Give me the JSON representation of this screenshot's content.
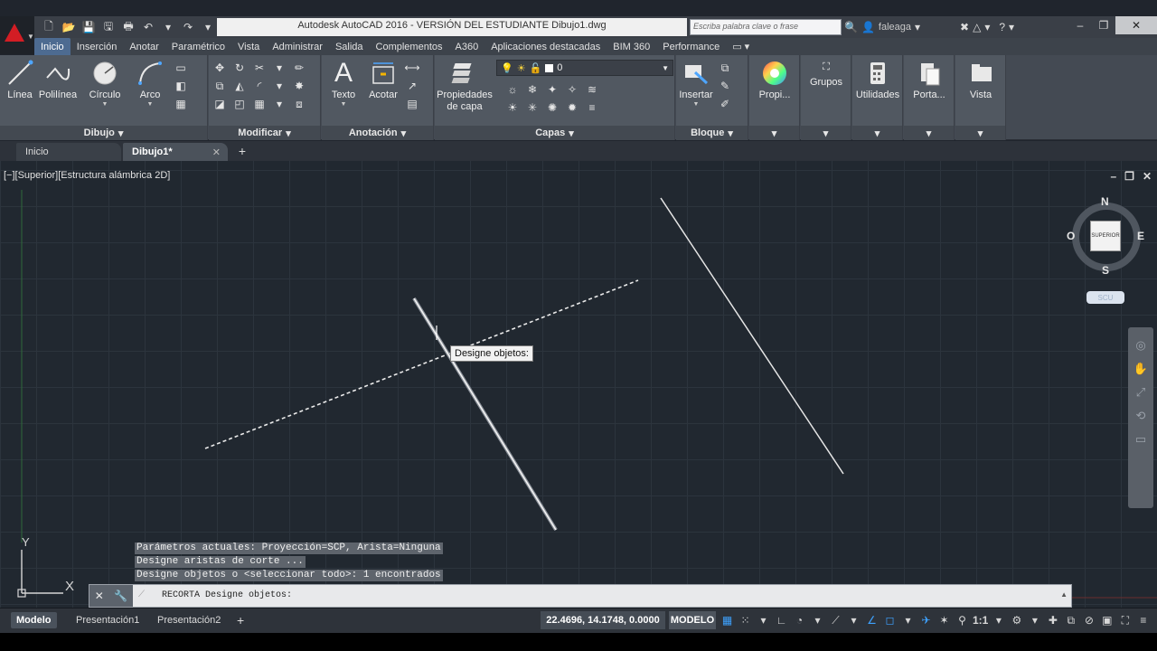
{
  "window": {
    "title": "Autodesk AutoCAD 2016 - VERSIÓN DEL ESTUDIANTE    Dibujo1.dwg",
    "search_placeholder": "Escriba palabra clave o frase",
    "user": "faleaga"
  },
  "ribbon_tabs": [
    "Inicio",
    "Inserción",
    "Anotar",
    "Paramétrico",
    "Vista",
    "Administrar",
    "Salida",
    "Complementos",
    "A360",
    "Aplicaciones destacadas",
    "BIM 360",
    "Performance"
  ],
  "ribbon": {
    "dibujo": {
      "title": "Dibujo",
      "linea": "Línea",
      "polilinea": "Polilínea",
      "circulo": "Círculo",
      "arco": "Arco"
    },
    "modificar": {
      "title": "Modificar"
    },
    "anotacion": {
      "title": "Anotación",
      "texto": "Texto",
      "acotar": "Acotar"
    },
    "capas": {
      "title": "Capas",
      "propiedades": "Propiedades",
      "de_capa": "de capa",
      "layer_value": "0"
    },
    "bloque": {
      "title": "Bloque",
      "insertar": "Insertar"
    },
    "propi": "Propi...",
    "grupos": "Grupos",
    "utilidades": "Utilidades",
    "porta": "Porta...",
    "vista": "Vista"
  },
  "doc_tabs": {
    "inicio": "Inicio",
    "dibujo1": "Dibujo1*"
  },
  "viewport": {
    "label": "[−][Superior][Estructura alámbrica 2D]",
    "tooltip": "Designe objetos:",
    "viewcube": {
      "n": "N",
      "s": "S",
      "e": "E",
      "o": "O",
      "face": "SUPERIOR",
      "scu": "SCU"
    },
    "ucs_y": "Y",
    "ucs_x": "X"
  },
  "command": {
    "history": [
      "Parámetros actuales: Proyección=SCP, Arista=Ninguna",
      "Designe aristas de corte ...",
      "Designe objetos o <seleccionar todo>: 1 encontrados"
    ],
    "current": "RECORTA Designe objetos:"
  },
  "status": {
    "layout_tabs": [
      "Modelo",
      "Presentación1",
      "Presentación2"
    ],
    "coords": "22.4696, 14.1748, 0.0000",
    "space": "MODELO",
    "scale": "1:1"
  },
  "colors": {
    "accent": "#4d6b91",
    "background": "#212830",
    "snap_on": "#3ea2ff",
    "logo": "#d31d24"
  }
}
